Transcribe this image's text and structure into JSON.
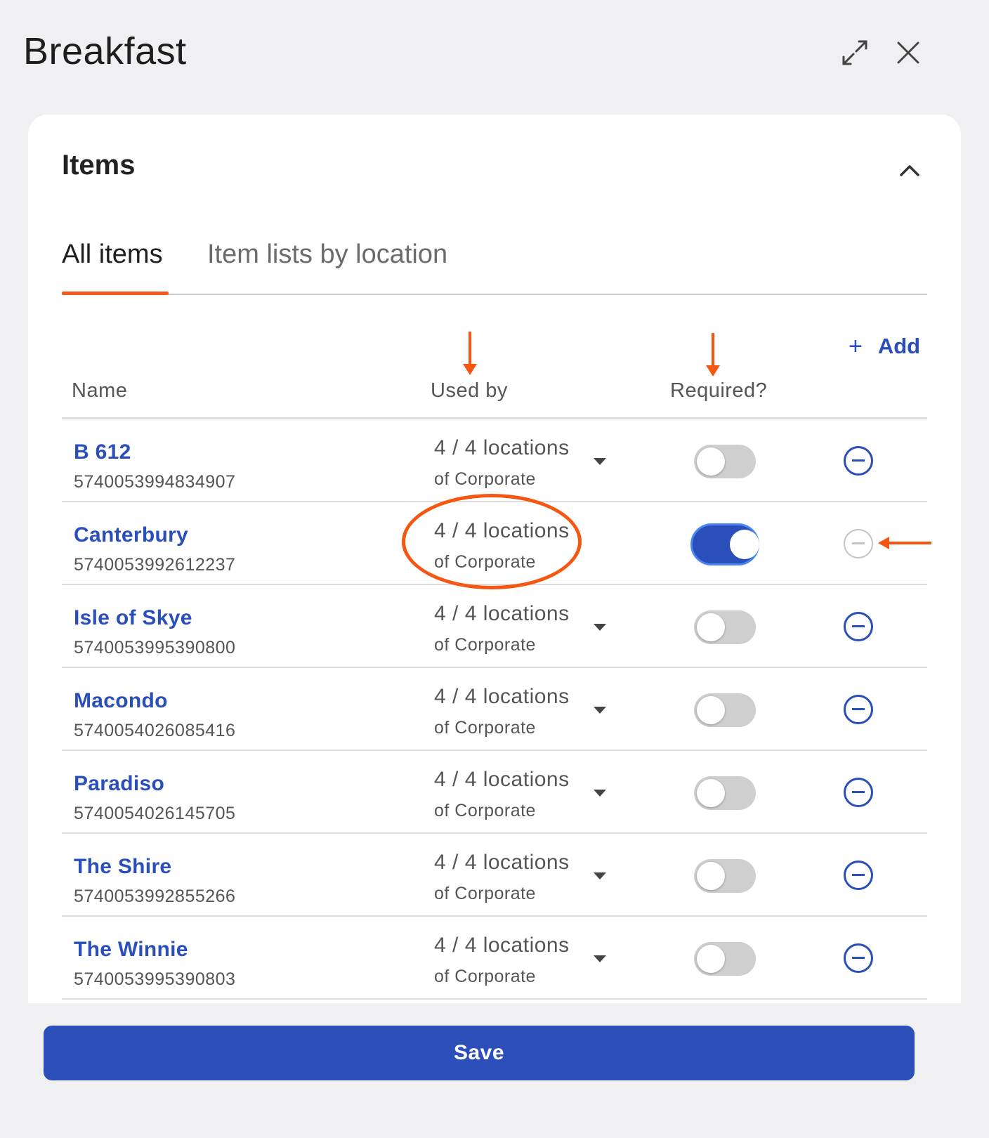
{
  "header": {
    "title": "Breakfast",
    "expand_icon": "expand-arrows-icon",
    "close_icon": "close-x-icon"
  },
  "section": {
    "title": "Items",
    "collapse_icon": "chevron-up-icon"
  },
  "tabs": [
    {
      "label": "All items",
      "active": true
    },
    {
      "label": "Item lists by location",
      "active": false
    }
  ],
  "add_button": {
    "icon": "+",
    "label": "Add"
  },
  "columns": {
    "name": "Name",
    "used_by": "Used by",
    "required": "Required?"
  },
  "rows": [
    {
      "name": "B 612",
      "code": "5740053994834907",
      "used_by": "4 / 4 locations",
      "used_by_sub": "of Corporate",
      "required": false
    },
    {
      "name": "Canterbury",
      "code": "5740053992612237",
      "used_by": "4 / 4 locations",
      "used_by_sub": "of Corporate",
      "required": true
    },
    {
      "name": "Isle of Skye",
      "code": "5740053995390800",
      "used_by": "4 / 4 locations",
      "used_by_sub": "of Corporate",
      "required": false
    },
    {
      "name": "Macondo",
      "code": "5740054026085416",
      "used_by": "4 / 4 locations",
      "used_by_sub": "of Corporate",
      "required": false
    },
    {
      "name": "Paradiso",
      "code": "5740054026145705",
      "used_by": "4 / 4 locations",
      "used_by_sub": "of Corporate",
      "required": false
    },
    {
      "name": "The Shire",
      "code": "5740053992855266",
      "used_by": "4 / 4 locations",
      "used_by_sub": "of Corporate",
      "required": false
    },
    {
      "name": "The Winnie",
      "code": "5740053995390803",
      "used_by": "4 / 4 locations",
      "used_by_sub": "of Corporate",
      "required": false
    }
  ],
  "save_button": {
    "label": "Save"
  },
  "colors": {
    "accent": "#2a4fba",
    "annotation": "#f55611",
    "tab_underline": "#f25a1c"
  }
}
